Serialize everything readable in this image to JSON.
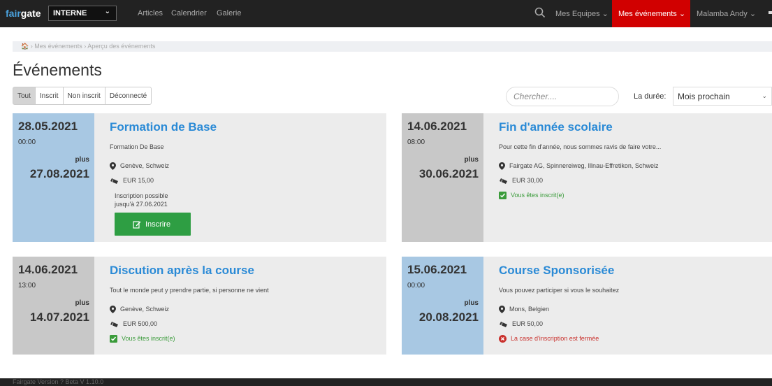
{
  "nav": {
    "logo_accent": "fair",
    "logo_rest": "gate",
    "org_select": "INTERNE",
    "links": [
      "Articles",
      "Calendrier",
      "Galerie"
    ],
    "teams": "Mes Equipes",
    "events": "Mes événements",
    "user": "Malamba Andy",
    "colors": {
      "bar": "#222222",
      "active": "#d10000",
      "brand": "#4aa3df"
    }
  },
  "breadcrumb": {
    "home_icon": "home-icon",
    "item1": "Mes événements",
    "item2": "Aperçu des événements"
  },
  "page_title": "Événements",
  "filters": {
    "all": "Tout",
    "registered": "Inscrit",
    "not_registered": "Non inscrit",
    "logged_out": "Déconnecté",
    "active": "Tout"
  },
  "search": {
    "placeholder": "Chercher...."
  },
  "duration": {
    "label": "La durée:",
    "value": "Mois prochain"
  },
  "events": [
    {
      "start_date": "28.05.2021",
      "start_time": "00:00",
      "plus": "plus",
      "end_date": "27.08.2021",
      "title": "Formation de Base",
      "description": "Formation De Base",
      "location": "Genève, Schweiz",
      "price": "EUR 15,00",
      "note_line1": "Inscription possible",
      "note_line2": "jusqu'à 27.06.2021",
      "button": "Inscrire",
      "date_color": "#a8c8e3"
    },
    {
      "start_date": "14.06.2021",
      "start_time": "08:00",
      "plus": "plus",
      "end_date": "30.06.2021",
      "title": "Fin d'année scolaire",
      "description": "Pour cette fin d'année, nous sommes ravis de faire votre...",
      "location": "Fairgate AG, Spinnereiweg, Illnau-Effretikon, Schweiz",
      "price": "EUR 30,00",
      "status": "Vous êtes inscrit(e)",
      "date_color": "#c8c8c8"
    },
    {
      "start_date": "14.06.2021",
      "start_time": "13:00",
      "plus": "plus",
      "end_date": "14.07.2021",
      "title": "Discution après la course",
      "description": "Tout le monde peut y prendre partie, si personne ne vient",
      "location": "Genève, Schweiz",
      "price": "EUR 500,00",
      "status": "Vous êtes inscrit(e)",
      "date_color": "#c8c8c8"
    },
    {
      "start_date": "15.06.2021",
      "start_time": "00:00",
      "plus": "plus",
      "end_date": "20.08.2021",
      "title": "Course Sponsorisée",
      "description": "Vous pouvez participer si vous le souhaitez",
      "location": "Mons, Belgien",
      "price": "EUR 50,00",
      "status_closed": "La case d'inscription est fermée",
      "date_color": "#a8c8e3"
    }
  ],
  "footer": {
    "text": "Fairgate Version ? Beta V 1.10.0"
  }
}
